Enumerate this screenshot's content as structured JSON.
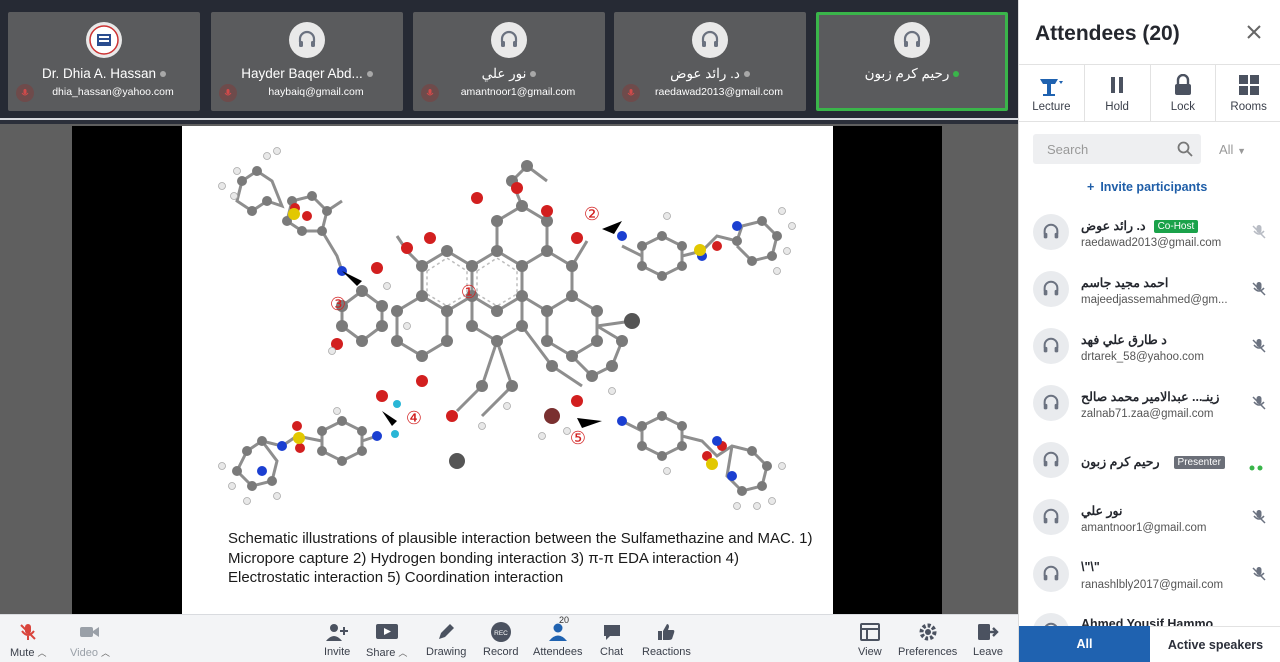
{
  "thumbnails": [
    {
      "name": "Dr. Dhia A. Hassan",
      "email": "dhia_hassan@yahoo.com",
      "avatar": "logo",
      "muted": true
    },
    {
      "name": "Hayder Baqer Abd...",
      "email": "haybaiq@gmail.com",
      "avatar": "headset-icon",
      "muted": true
    },
    {
      "name": "نور علي",
      "email": "amantnoor1@gmail.com",
      "avatar": "headset-icon",
      "muted": true
    },
    {
      "name": "د. رائد عوض",
      "email": "raedawad2013@gmail.com",
      "avatar": "headset-icon",
      "muted": true
    },
    {
      "name": "رحيم كرم زبون",
      "email": "",
      "avatar": "headset-icon",
      "muted": false,
      "speaking": true
    }
  ],
  "slide": {
    "labels": [
      "①",
      "②",
      "③",
      "④",
      "⑤"
    ],
    "caption": "Schematic illustrations of plausible interaction between the Sulfamethazine and MAC. 1) Micropore capture 2) Hydrogen bonding interaction 3) π-π EDA interaction 4) Electrostatic interaction 5) Coordination interaction"
  },
  "toolbar": {
    "mute": "Mute",
    "video": "Video",
    "invite": "Invite",
    "share": "Share",
    "drawing": "Drawing",
    "record": "Record",
    "record_badge": "REC",
    "attendees": "Attendees",
    "attendees_count": "20",
    "chat": "Chat",
    "reactions": "Reactions",
    "view": "View",
    "preferences": "Preferences",
    "leave": "Leave"
  },
  "panel": {
    "title": "Attendees (20)",
    "tools": [
      "Lecture",
      "Hold",
      "Lock",
      "Rooms"
    ],
    "search_placeholder": "Search",
    "filter": "All",
    "invite": "Invite participants",
    "attendees": [
      {
        "name": "د. رائد عوض",
        "email": "raedawad2013@gmail.com",
        "role": "Co-Host"
      },
      {
        "name": "احمد مجيد جاسم",
        "email": "majeedjassemahmed@gm..."
      },
      {
        "name": "د طارق علي فهد",
        "email": "drtarek_58@yahoo.com"
      },
      {
        "name": "زينـ... عبدالامير محمد صالح",
        "email": "zalnab71.zaa@gmail.com"
      },
      {
        "name": "رحيم كرم زبون",
        "email": "",
        "role": "Presenter"
      },
      {
        "name": "نور علي",
        "email": "amantnoor1@gmail.com"
      },
      {
        "name": "\\\"\\\"",
        "email": "ranashlbly2017@gmail.com"
      },
      {
        "name": "Ahmed Yousif Hammo...",
        "email": ""
      }
    ],
    "tabs": [
      "All",
      "Active speakers"
    ]
  },
  "colors": {
    "accent": "#1f62b0",
    "active_speaker": "#3ab54a",
    "cohost": "#1aa24a"
  }
}
